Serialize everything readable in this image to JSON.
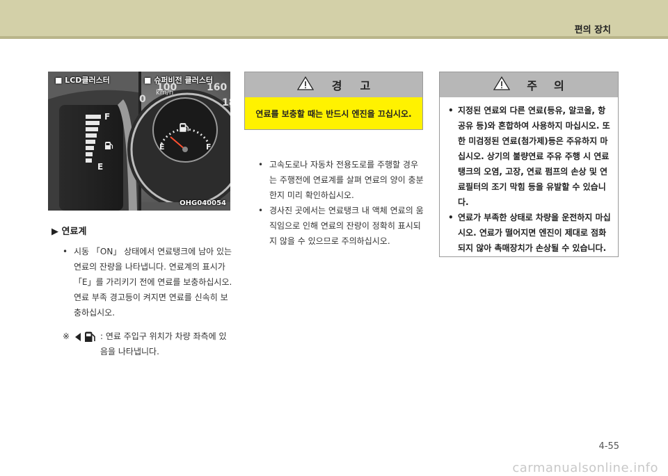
{
  "header": {
    "section": "편의 장치"
  },
  "figure": {
    "label_left": "■ LCD클러스터",
    "label_right": "■ 슈퍼비전 클러스터",
    "code": "OHG040054",
    "gauge_f": "F",
    "gauge_e": "E",
    "speed_unit": "km/h",
    "speed_0": "0",
    "speed_100": "100",
    "speed_160": "160",
    "speed_18": "18",
    "dial_e": "E",
    "dial_f": "F"
  },
  "fuel_gauge": {
    "heading": "▶ 연료계",
    "items": [
      "시동 「ON」 상태에서 연료탱크에 남아 있는 연료의 잔량을 나타냅니다. 연료계의 표시가 「E」를 가리키기 전에 연료를 보충하십시오. 연료 부족 경고등이 켜지면 연료를 신속히 보충하십시오."
    ],
    "note_mark": "※",
    "note_text": ": 연료 주입구 위치가 차량 좌측에 있음을 나타냅니다."
  },
  "warning": {
    "title_1": "경",
    "title_2": "고",
    "body": "연료를 보충할 때는 반드시 엔진을 끄십시오.",
    "items": [
      "고속도로나 자동차 전용도로를 주행할 경우는 주행전에 연료계를 살펴 연료의 양이 충분한지 미리 확인하십시오.",
      "경사진 곳에서는 연료탱크 내 액체 연료의 움직임으로 인해 연료의 잔량이 정확히 표시되지 않을 수 있으므로 주의하십시오."
    ]
  },
  "caution": {
    "title_1": "주",
    "title_2": "의",
    "items": [
      "지정된 연료외 다른 연료(등유, 알코올, 항공유 등)와 혼합하여 사용하지 마십시오. 또한 미검정된 연료(첨가제)등은 주유하지 마십시오. 상기의 불량연료 주유 주행 시 연료 탱크의 오염, 고장, 연료 펌프의 손상 및 연료필터의 조기 막힘 등을 유발할 수 있습니다.",
      "연료가 부족한 상태로 차량을 운전하지 마십시오. 연료가 떨어지면 엔진이 제대로 점화되지 않아 촉매장치가 손상될 수 있습니다."
    ]
  },
  "footer": {
    "page": "4-55",
    "watermark": "carmanualsonline.info"
  },
  "colors": {
    "header_band": "#d3d0a8",
    "warning_yellow": "#fff200",
    "box_title_gray": "#b7b7b7"
  },
  "icons": {
    "warning": "warning-triangle-icon",
    "fuel_pump": "fuel-pump-icon"
  }
}
